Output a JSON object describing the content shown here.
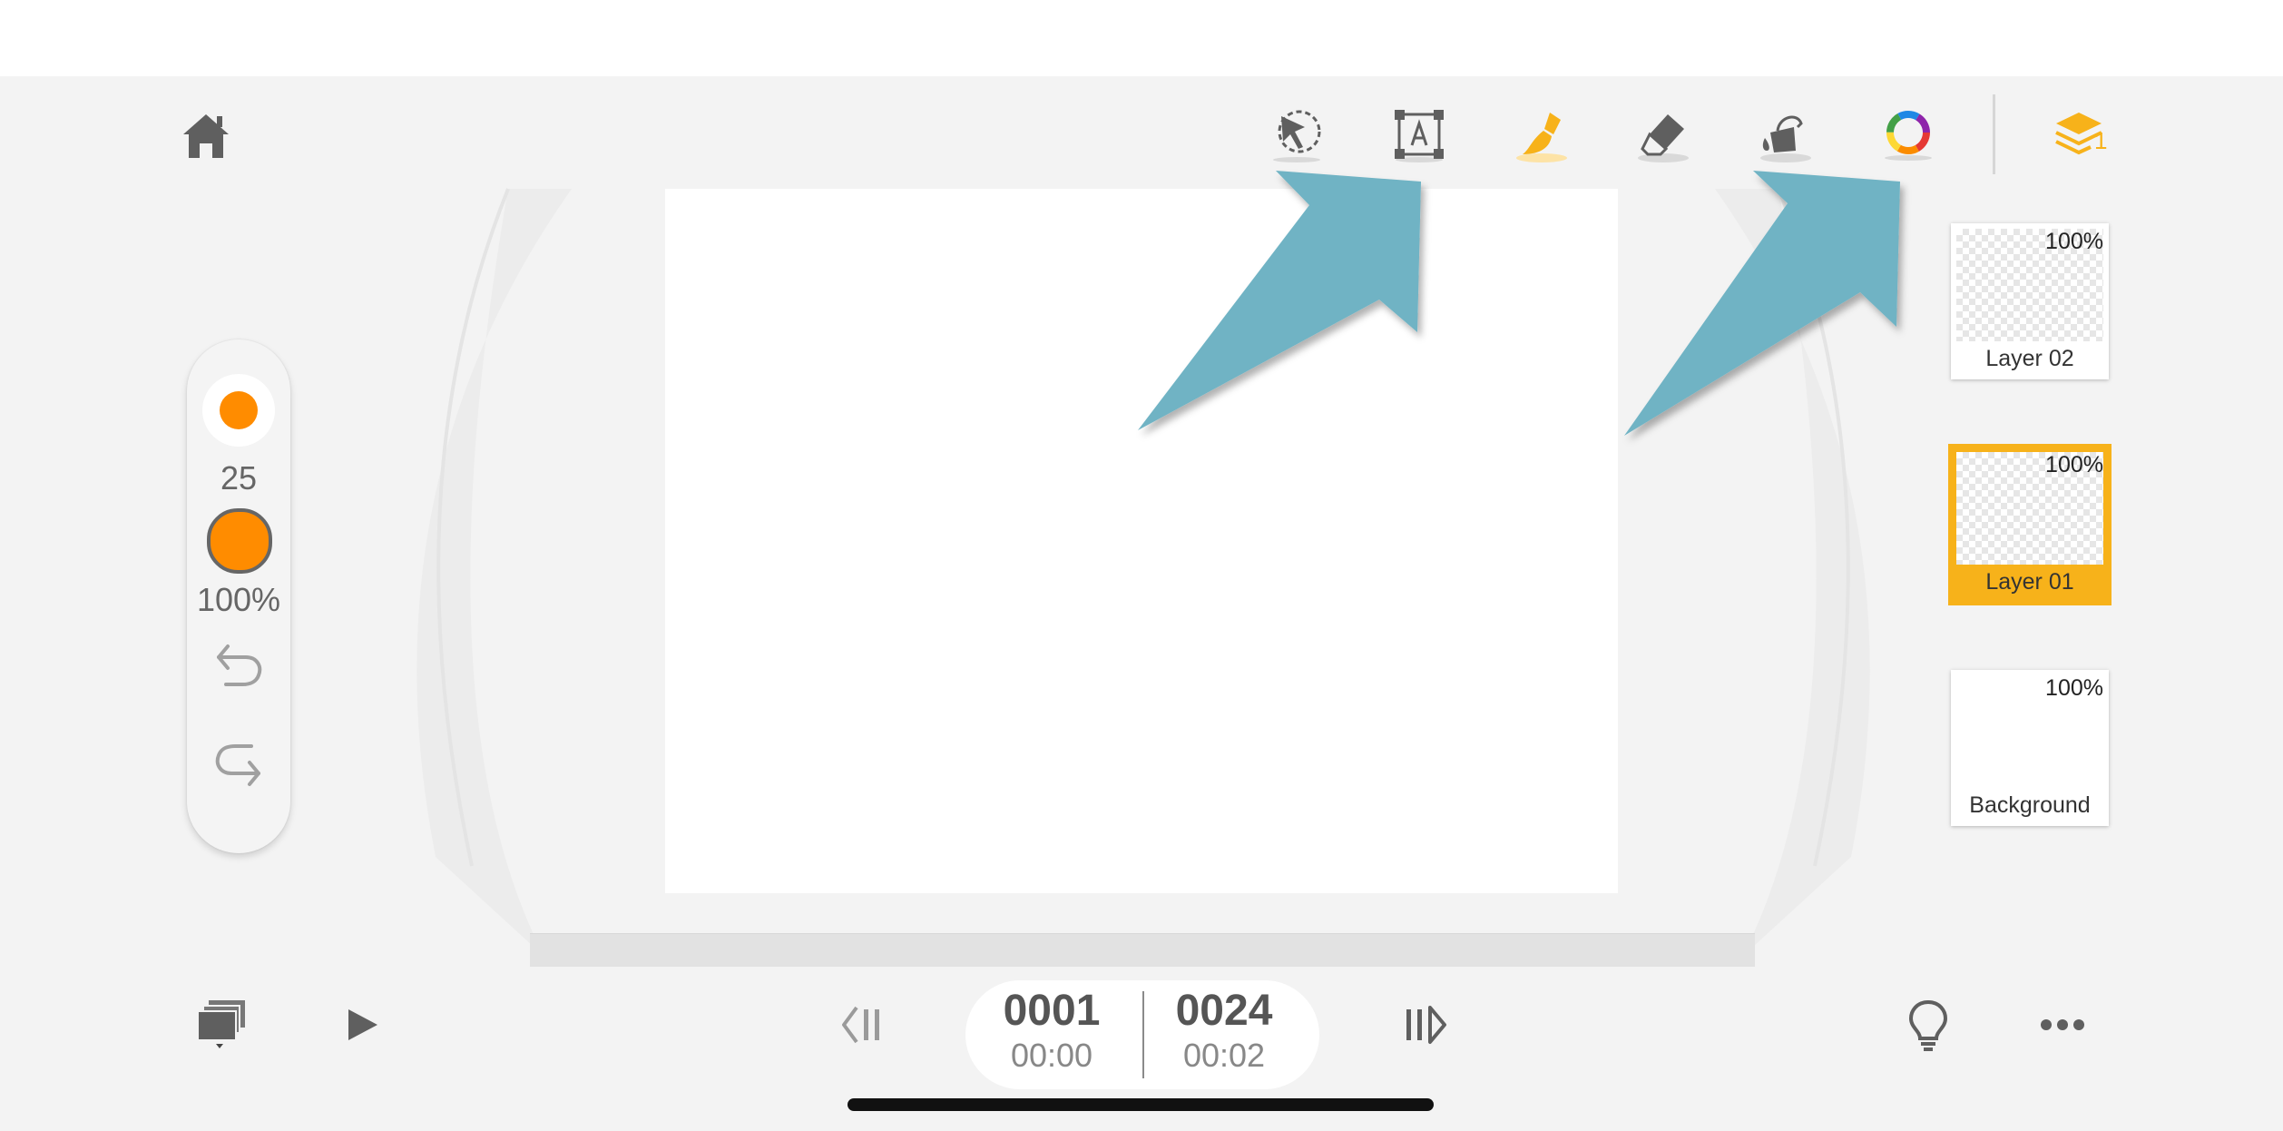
{
  "toolbar": {
    "home_icon": "home-icon",
    "tools": [
      {
        "name": "selection-tool",
        "icon": "lasso-select-icon",
        "active": false
      },
      {
        "name": "text-tool",
        "icon": "text-box-icon",
        "active": false
      },
      {
        "name": "brush-tool",
        "icon": "brush-icon",
        "active": true
      },
      {
        "name": "eraser-tool",
        "icon": "eraser-icon",
        "active": false
      },
      {
        "name": "fill-tool",
        "icon": "paint-bucket-icon",
        "active": false
      },
      {
        "name": "color-picker",
        "icon": "color-wheel-icon",
        "active": false
      }
    ],
    "layers_badge": "1"
  },
  "brush_panel": {
    "size": "25",
    "opacity": "100%",
    "color": "#ff8c00"
  },
  "layers": [
    {
      "name": "Layer 02",
      "opacity": "100%",
      "selected": false
    },
    {
      "name": "Layer 01",
      "opacity": "100%",
      "selected": true
    },
    {
      "name": "Background",
      "opacity": "100%",
      "selected": false
    }
  ],
  "playback": {
    "current_frame": "0001",
    "current_time": "00:00",
    "total_frames": "0024",
    "total_time": "00:02"
  },
  "colors": {
    "accent": "#f7b21a",
    "arrow": "#6fb3c4",
    "icon": "#5f5f5f"
  }
}
